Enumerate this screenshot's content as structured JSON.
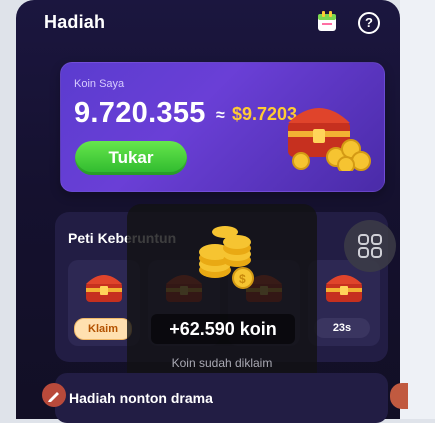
{
  "header": {
    "title": "Hadiah",
    "help": "?"
  },
  "coin_card": {
    "label": "Koin Saya",
    "amount": "9.720.355",
    "approx_symbol": "≈",
    "money_value": "$9.7203",
    "button_label": "Tukar"
  },
  "chest_section": {
    "title": "Peti Keberuntun",
    "slots": [
      {
        "badge": "Klaim"
      },
      {
        "badge": ""
      },
      {
        "badge": ""
      },
      {
        "badge": "23s"
      }
    ]
  },
  "toast": {
    "amount": "+62.590 koin",
    "message": "Koin sudah diklaim"
  },
  "drama": {
    "title": "Hadiah nonton drama"
  },
  "colors": {
    "accent_green": "#2db82d",
    "money_gold": "#ffcc33",
    "card_purple": "#5b3ccf"
  }
}
